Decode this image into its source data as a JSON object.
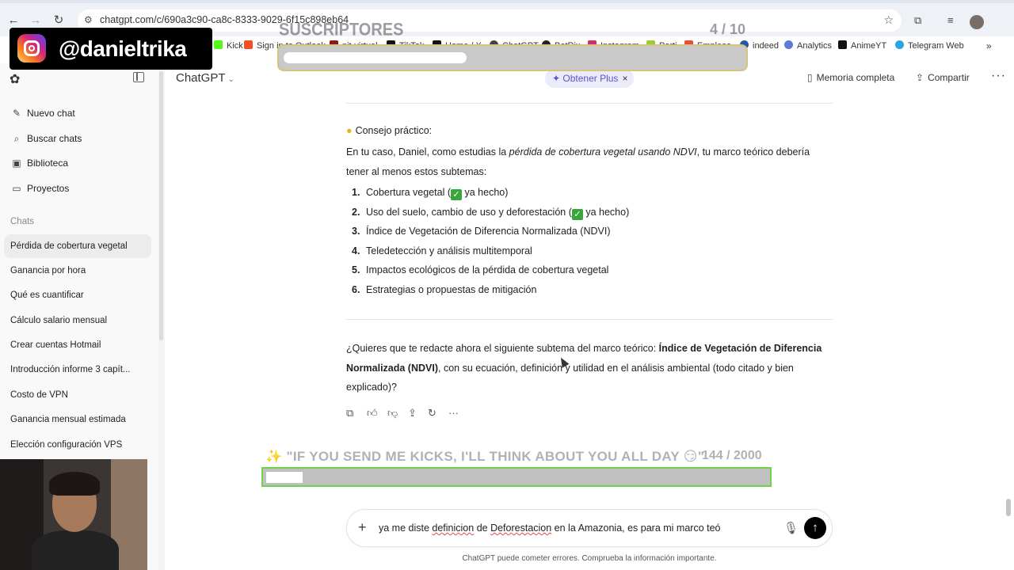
{
  "browser": {
    "url": "chatgpt.com/c/690a3c90-ca8c-8333-9029-6f15c898eb64",
    "bookmarks": [
      "Kick",
      "Sign in to Outlook",
      "pit-virtual",
      "TikTok",
      "Home / X",
      "ChatGPT",
      "BotRix",
      "Instagram",
      "Parti",
      "Empleos",
      "indeed",
      "Analytics",
      "AnimeYT",
      "Telegram Web"
    ]
  },
  "overlay": {
    "instagram_handle": "@danieltrika",
    "subs_title": "SUSCRIPTORES",
    "subs_count": "4  / 10",
    "subs_progress": 0.4,
    "kicks_title": "\"IF YOU SEND ME KICKS, I'LL THINK ABOUT YOU ALL DAY 😏\"",
    "kicks_count": "144  / 2000",
    "kicks_progress": 0.072
  },
  "sidebar": {
    "actions": [
      {
        "icon": "edit-icon",
        "label": "Nuevo chat"
      },
      {
        "icon": "search-icon",
        "label": "Buscar chats"
      },
      {
        "icon": "library-icon",
        "label": "Biblioteca"
      },
      {
        "icon": "folder-icon",
        "label": "Proyectos"
      }
    ],
    "section_label": "Chats",
    "chats": [
      "Pérdida de cobertura vegetal",
      "Ganancia por hora",
      "Qué es cuantificar",
      "Cálculo salario mensual",
      "Crear cuentas Hotmail",
      "Introducción informe 3 capít...",
      "Costo de VPN",
      "Ganancia mensual estimada",
      "Elección configuración VPS"
    ]
  },
  "header": {
    "model": "ChatGPT",
    "plus_pill": "Obtener Plus",
    "memory": "Memoria completa",
    "share": "Compartir"
  },
  "message": {
    "tip_title": "Consejo práctico:",
    "intro_a": "En tu caso, Daniel, como estudias la ",
    "intro_em": "pérdida de cobertura vegetal usando NDVI",
    "intro_b": ", tu marco teórico debería",
    "intro_c": "tener al menos estos subtemas:",
    "list": [
      {
        "n": "1.",
        "pre": "Cobertura vegetal (",
        "check": true,
        "post": " ya hecho)"
      },
      {
        "n": "2.",
        "pre": "Uso del suelo, cambio de uso y deforestación (",
        "check": true,
        "post": " ya hecho)"
      },
      {
        "n": "3.",
        "pre": "Índice de Vegetación de Diferencia Normalizada (NDVI)",
        "check": false,
        "post": ""
      },
      {
        "n": "4.",
        "pre": "Teledetección y análisis multitemporal",
        "check": false,
        "post": ""
      },
      {
        "n": "5.",
        "pre": "Impactos ecológicos de la pérdida de cobertura vegetal",
        "check": false,
        "post": ""
      },
      {
        "n": "6.",
        "pre": "Estrategias o propuestas de mitigación",
        "check": false,
        "post": ""
      }
    ],
    "question_a": "¿Quieres que te redacte ahora el siguiente subtema del marco teórico: ",
    "question_bold_1": "Índice de Vegetación de Diferencia",
    "question_bold_2": "Normalizada (NDVI)",
    "question_b": ", con su ecuación, definición y utilidad en el análisis ambiental (todo citado y bien",
    "question_c": "explicado)?"
  },
  "composer": {
    "text_1": "ya me diste ",
    "text_sq1": "definicion",
    "text_2": " de ",
    "text_sq2": "Deforestacion",
    "text_3": " en la Amazonia, es para mi marco teó",
    "disclaimer": "ChatGPT puede cometer errores. Comprueba la información importante."
  }
}
